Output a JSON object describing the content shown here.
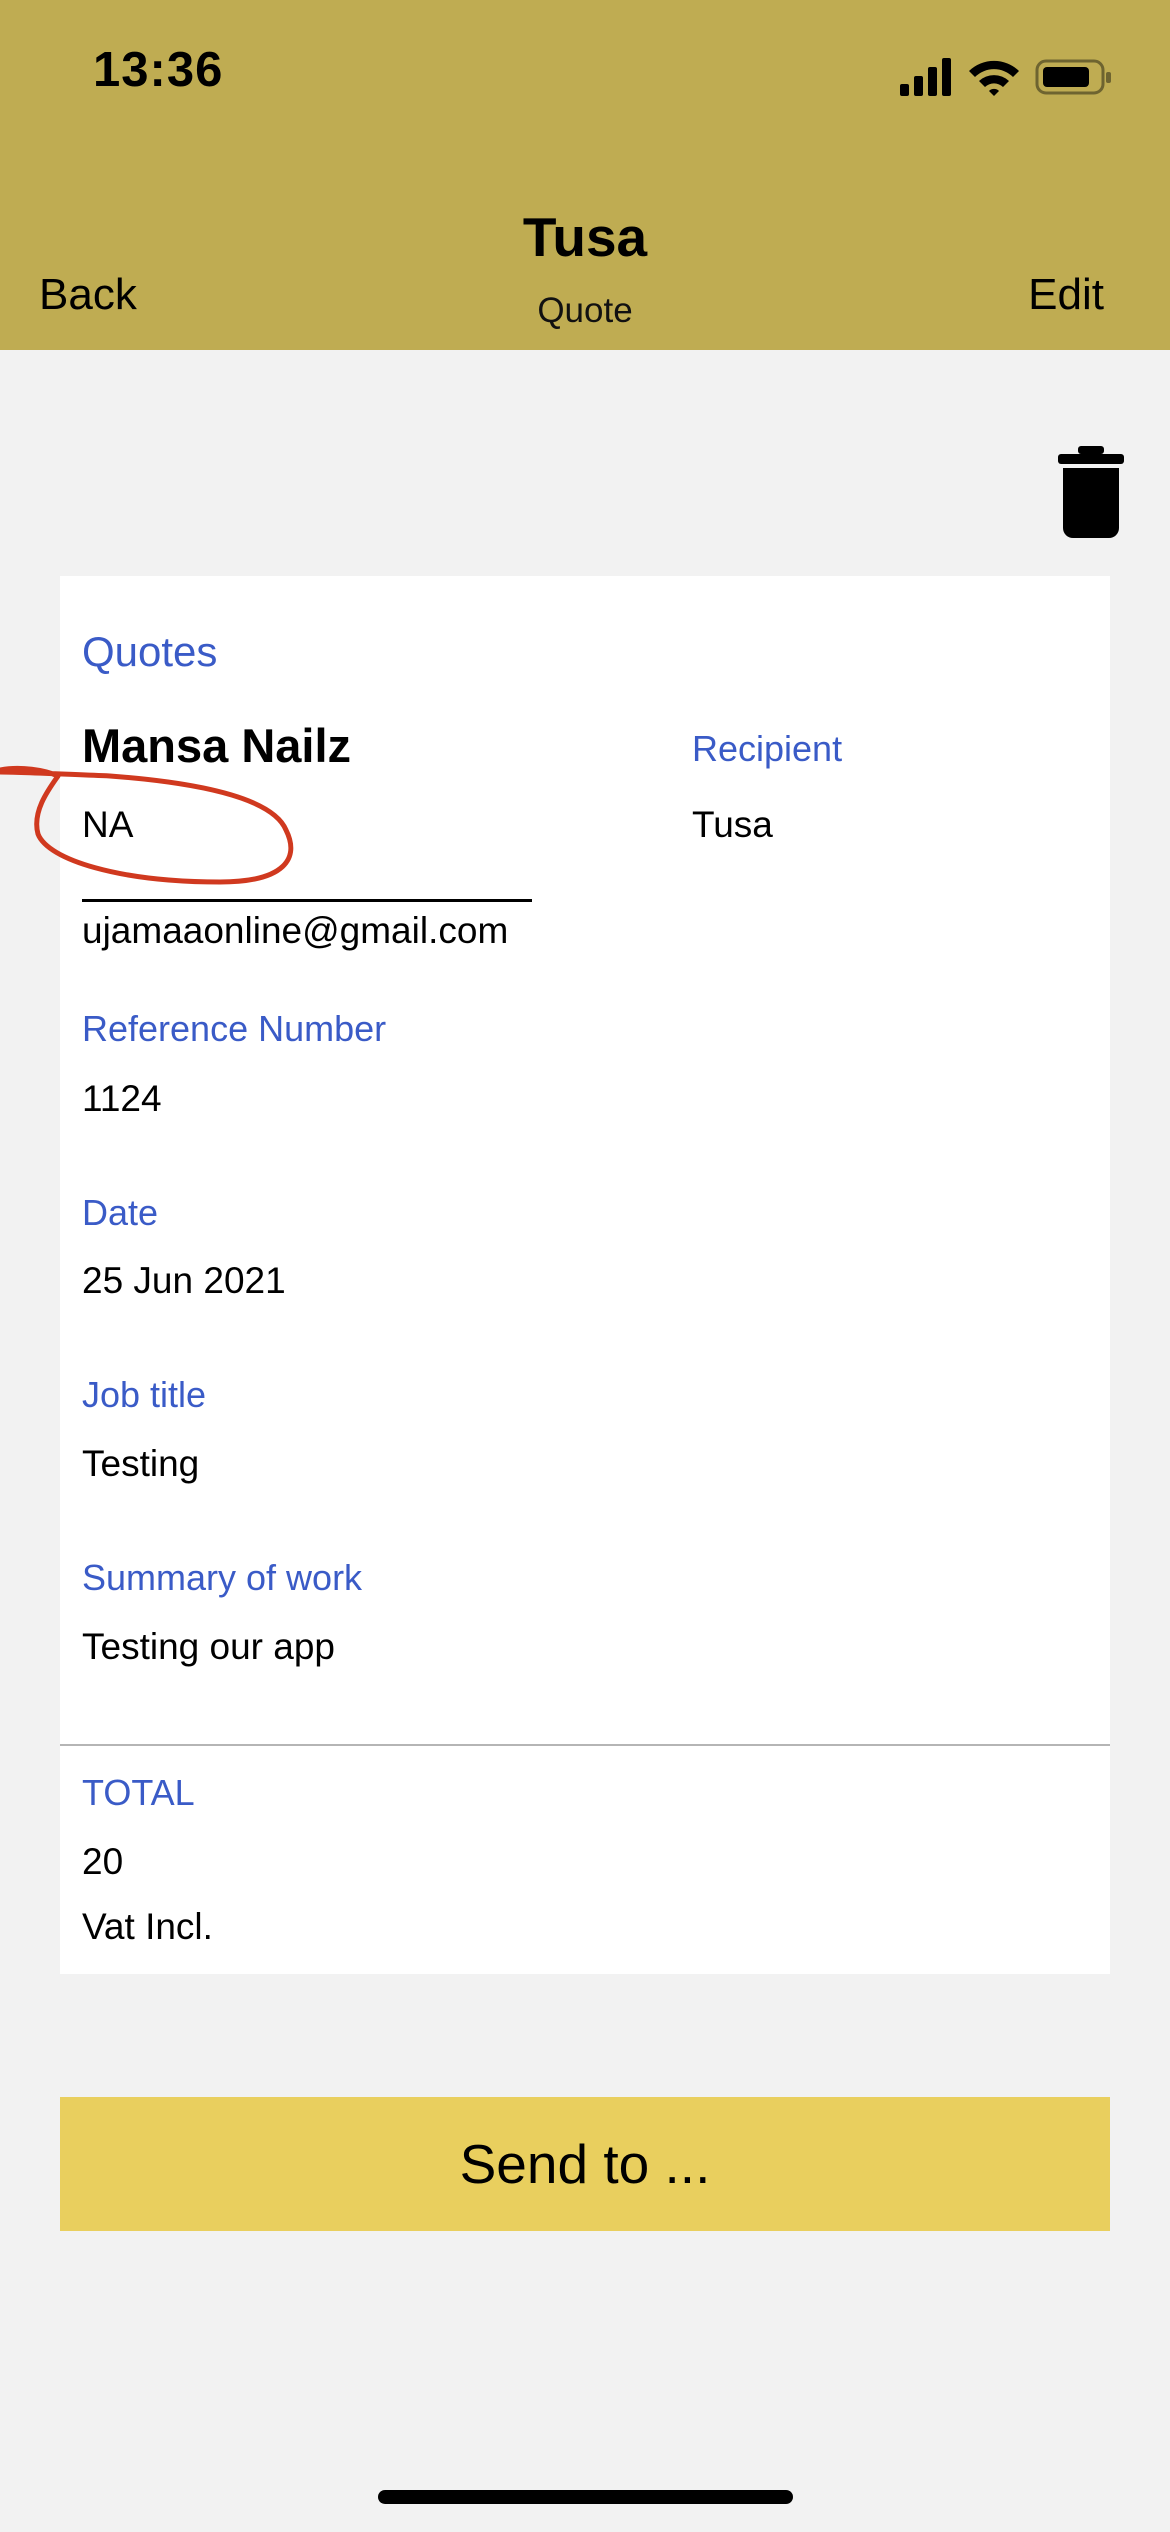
{
  "status_bar": {
    "time": "13:36"
  },
  "nav": {
    "title": "Tusa",
    "subtitle": "Quote",
    "back_label": "Back",
    "edit_label": "Edit"
  },
  "quote": {
    "section_title": "Quotes",
    "sender": {
      "company": "Mansa Nailz",
      "initials": "NA",
      "email": "ujamaaonline@gmail.com"
    },
    "recipient": {
      "label": "Recipient",
      "name": "Tusa"
    },
    "reference": {
      "label": "Reference Number",
      "value": "1124"
    },
    "date": {
      "label": "Date",
      "value": "25 Jun 2021"
    },
    "job_title": {
      "label": "Job title",
      "value": "Testing"
    },
    "summary": {
      "label": "Summary of work",
      "value": "Testing our app"
    },
    "total": {
      "label": "TOTAL",
      "value": "20",
      "vat_note": "Vat Incl."
    }
  },
  "actions": {
    "send_label": "Send to ..."
  },
  "colors": {
    "header_bg": "#bfac52",
    "accent_label": "#3a5bc7",
    "send_button_bg": "#e9cf5e",
    "annotation_stroke": "#d0391f",
    "page_bg": "#f2f2f2"
  },
  "icons": [
    "signal-icon",
    "wifi-icon",
    "battery-icon",
    "trash-icon"
  ]
}
